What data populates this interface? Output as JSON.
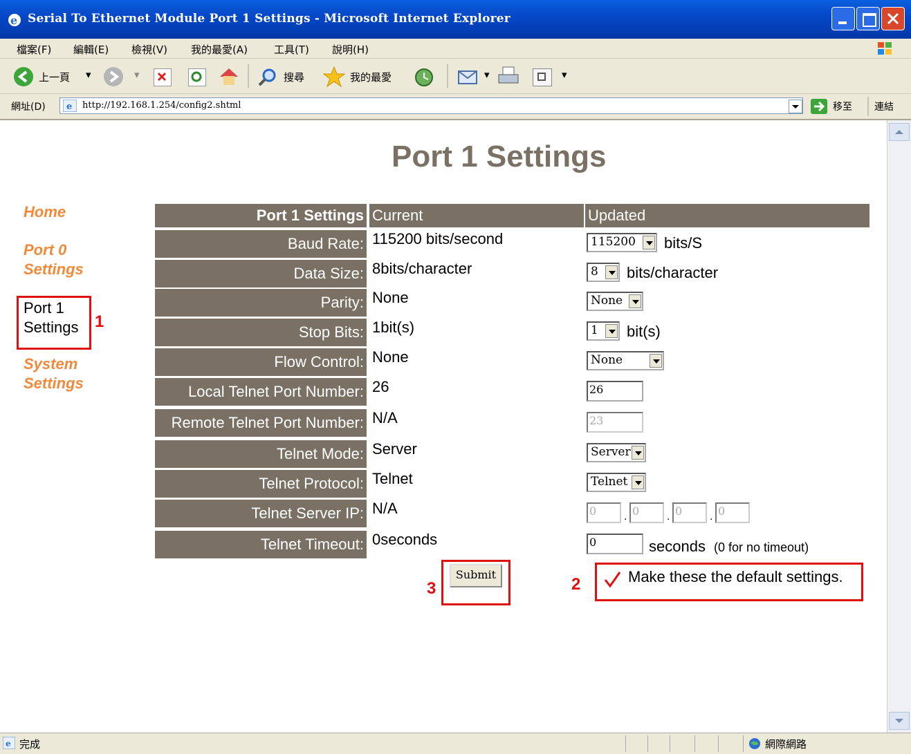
{
  "window": {
    "title": "Serial To Ethernet Module Port 1 Settings - Microsoft Internet Explorer"
  },
  "menu": [
    "檔案(F)",
    "編輯(E)",
    "檢視(V)",
    "我的最愛(A)",
    "工具(T)",
    "說明(H)"
  ],
  "toolbar": {
    "back": "上一頁",
    "search": "搜尋",
    "favorites": "我的最愛"
  },
  "address": {
    "label": "網址(D)",
    "url": "http://192.168.1.254/config2.shtml",
    "go": "移至",
    "links": "連結"
  },
  "page": {
    "title": "Port 1 Settings"
  },
  "nav": {
    "home": "Home",
    "port0": [
      "Port 0",
      "Settings"
    ],
    "port1": [
      "Port 1",
      "Settings"
    ],
    "system": [
      "System",
      "Settings"
    ]
  },
  "annotations": {
    "n1": "1",
    "n2": "2",
    "n3": "3"
  },
  "table": {
    "header": {
      "label": "Port 1 Settings",
      "current": "Current",
      "updated": "Updated"
    },
    "rows": [
      {
        "label": "Baud Rate:",
        "current": "115200 bits/second",
        "value": "115200",
        "unit": "bits/S"
      },
      {
        "label": "Data Size:",
        "current": "8bits/character",
        "value": "8",
        "unit": "bits/character"
      },
      {
        "label": "Parity:",
        "current": "None",
        "value": "None",
        "unit": ""
      },
      {
        "label": "Stop Bits:",
        "current": "1bit(s)",
        "value": "1",
        "unit": "bit(s)"
      },
      {
        "label": "Flow Control:",
        "current": "None",
        "value": "None",
        "unit": ""
      },
      {
        "label": "Local Telnet Port Number:",
        "current": "26",
        "value": "26",
        "unit": ""
      },
      {
        "label": "Remote Telnet Port Number:",
        "current": "N/A",
        "value": "23",
        "unit": ""
      },
      {
        "label": "Telnet Mode:",
        "current": "Server",
        "value": "Server",
        "unit": ""
      },
      {
        "label": "Telnet Protocol:",
        "current": "Telnet",
        "value": "Telnet",
        "unit": ""
      },
      {
        "label": "Telnet Server IP:",
        "current": "N/A",
        "ip": [
          "0",
          "0",
          "0",
          "0"
        ],
        "unit": ""
      },
      {
        "label": "Telnet Timeout:",
        "current": "0seconds",
        "value": "0",
        "unit": "seconds",
        "note": "(0 for no timeout)"
      }
    ]
  },
  "submit": {
    "label": "Submit"
  },
  "default_checkbox": {
    "label": "Make these the default settings.",
    "checked": true
  },
  "status": {
    "left": "完成",
    "zone": "網際網路"
  }
}
